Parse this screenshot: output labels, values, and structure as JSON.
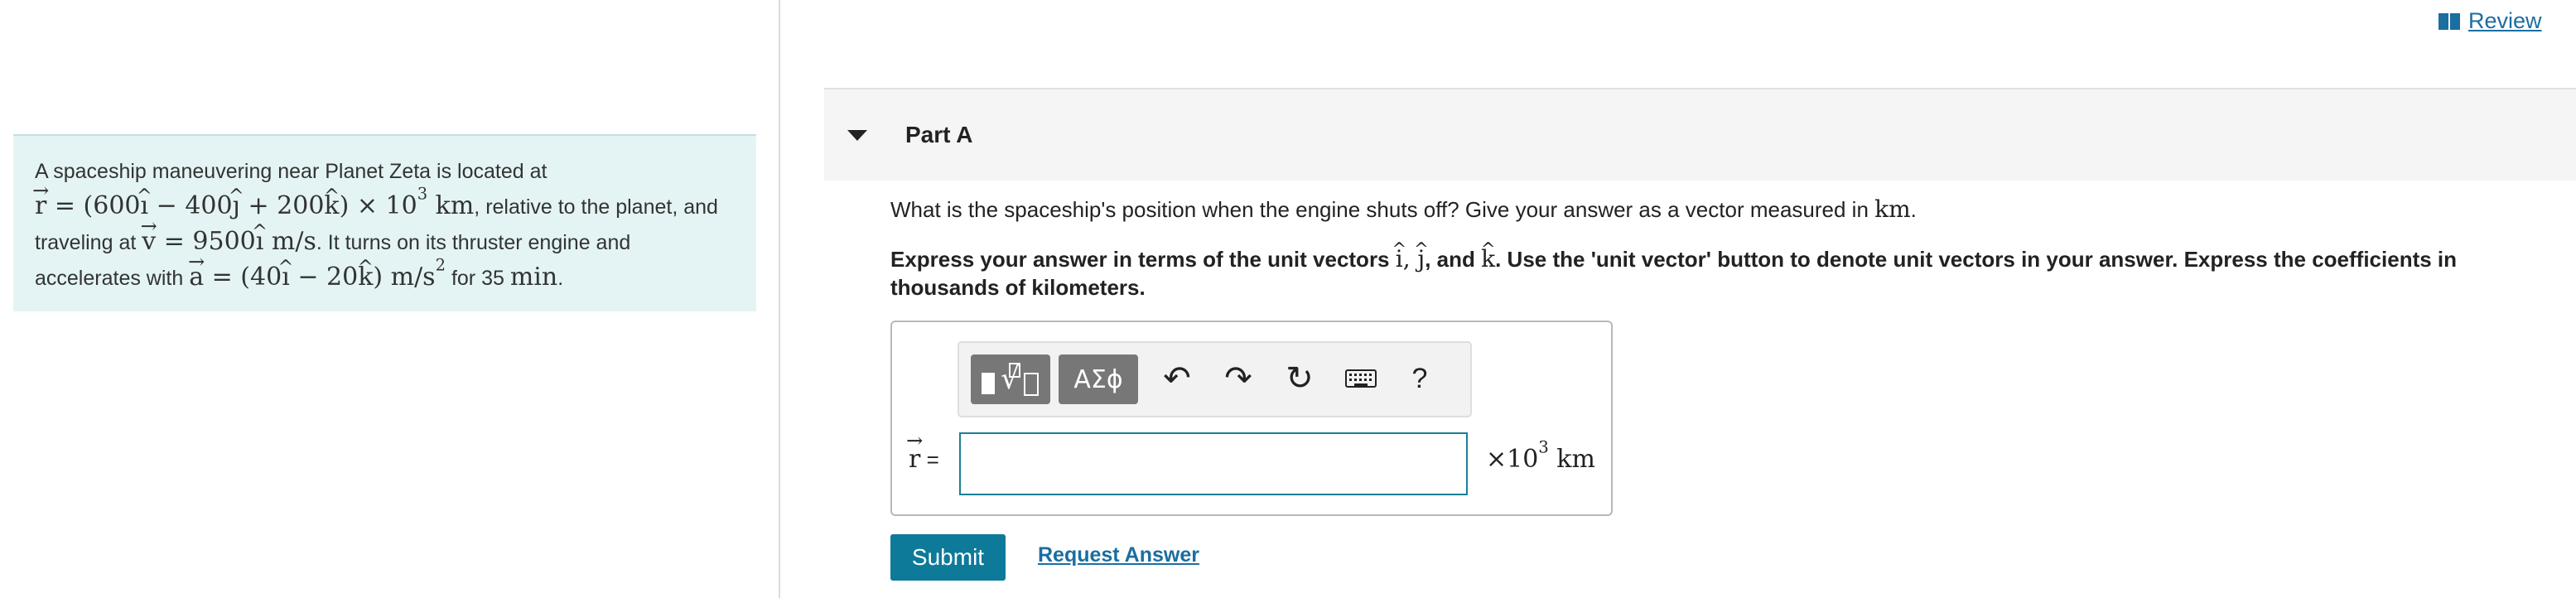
{
  "review": {
    "label": "Review",
    "icon": "book-icon"
  },
  "problem": {
    "line1": "A spaceship maneuvering near Planet Zeta is located at",
    "r_text": ", relative to the planet, and",
    "traveling_text": "traveling at",
    "v_text": ". It turns on its thruster engine and",
    "accel_text": "accelerates with",
    "for_text": " for 35",
    "min_unit": "min",
    "period": "."
  },
  "part": {
    "title": "Part A",
    "toggle_icon": "caret-down-icon"
  },
  "question": {
    "text": "What is the spaceship's position when the engine shuts off? Give your answer as a vector measured in",
    "unit": "km",
    "period": "."
  },
  "instructions": {
    "prefix": "Express your answer in terms of the unit vectors",
    "i": "i",
    "j": "j",
    "and": ", and",
    "k": "k",
    "suffix": ". Use the 'unit vector' button to denote unit vectors in your answer. Express the coefficients in thousands of kilometers."
  },
  "toolbar": {
    "templates_icon": "math-templates-icon",
    "greek_label": "ΑΣϕ",
    "undo_icon": "undo-icon",
    "redo_icon": "redo-icon",
    "reset_icon": "reset-icon",
    "keyboard_icon": "keyboard-icon",
    "help_label": "?"
  },
  "answer": {
    "label_var": "r",
    "equals": "=",
    "value": "",
    "units_prefix": "×10",
    "units_exp": "3",
    "units_suffix": " km"
  },
  "buttons": {
    "submit": "Submit",
    "request_answer": "Request Answer"
  },
  "colors": {
    "accent": "#0d7a9a",
    "link": "#1a6ea0",
    "problem_bg": "#e4f4f4",
    "input_border": "#1a7f97"
  }
}
